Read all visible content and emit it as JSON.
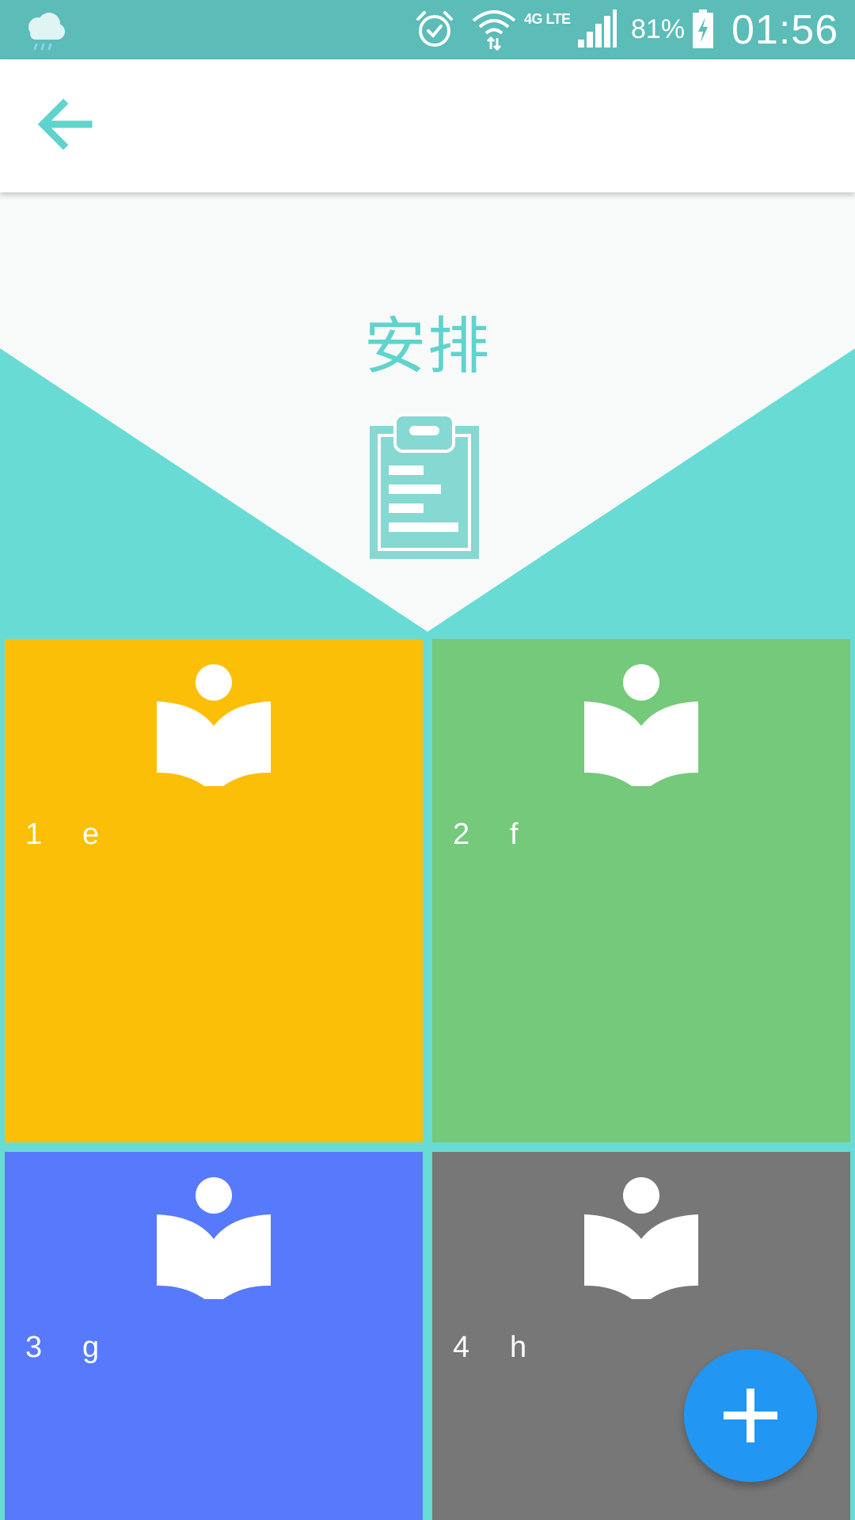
{
  "status_bar": {
    "weather_icon": "cloud-rain-icon",
    "network_type": "4G LTE",
    "battery_percent": "81%",
    "time": "01:56"
  },
  "app_bar": {
    "back_icon": "arrow-left-icon"
  },
  "header": {
    "title": "安排",
    "icon": "clipboard-icon",
    "accent_color": "#5fd3cc"
  },
  "tiles": [
    {
      "number": "1",
      "label": "e",
      "color": "#fcbf08",
      "icon": "reader-book-icon"
    },
    {
      "number": "2",
      "label": "f",
      "color": "#75c97b",
      "icon": "reader-book-icon"
    },
    {
      "number": "3",
      "label": "g",
      "color": "#5779fb",
      "icon": "reader-book-icon"
    },
    {
      "number": "4",
      "label": "h",
      "color": "#777777",
      "icon": "reader-book-icon"
    }
  ],
  "fab": {
    "icon": "plus-icon",
    "color": "#2196f3"
  }
}
